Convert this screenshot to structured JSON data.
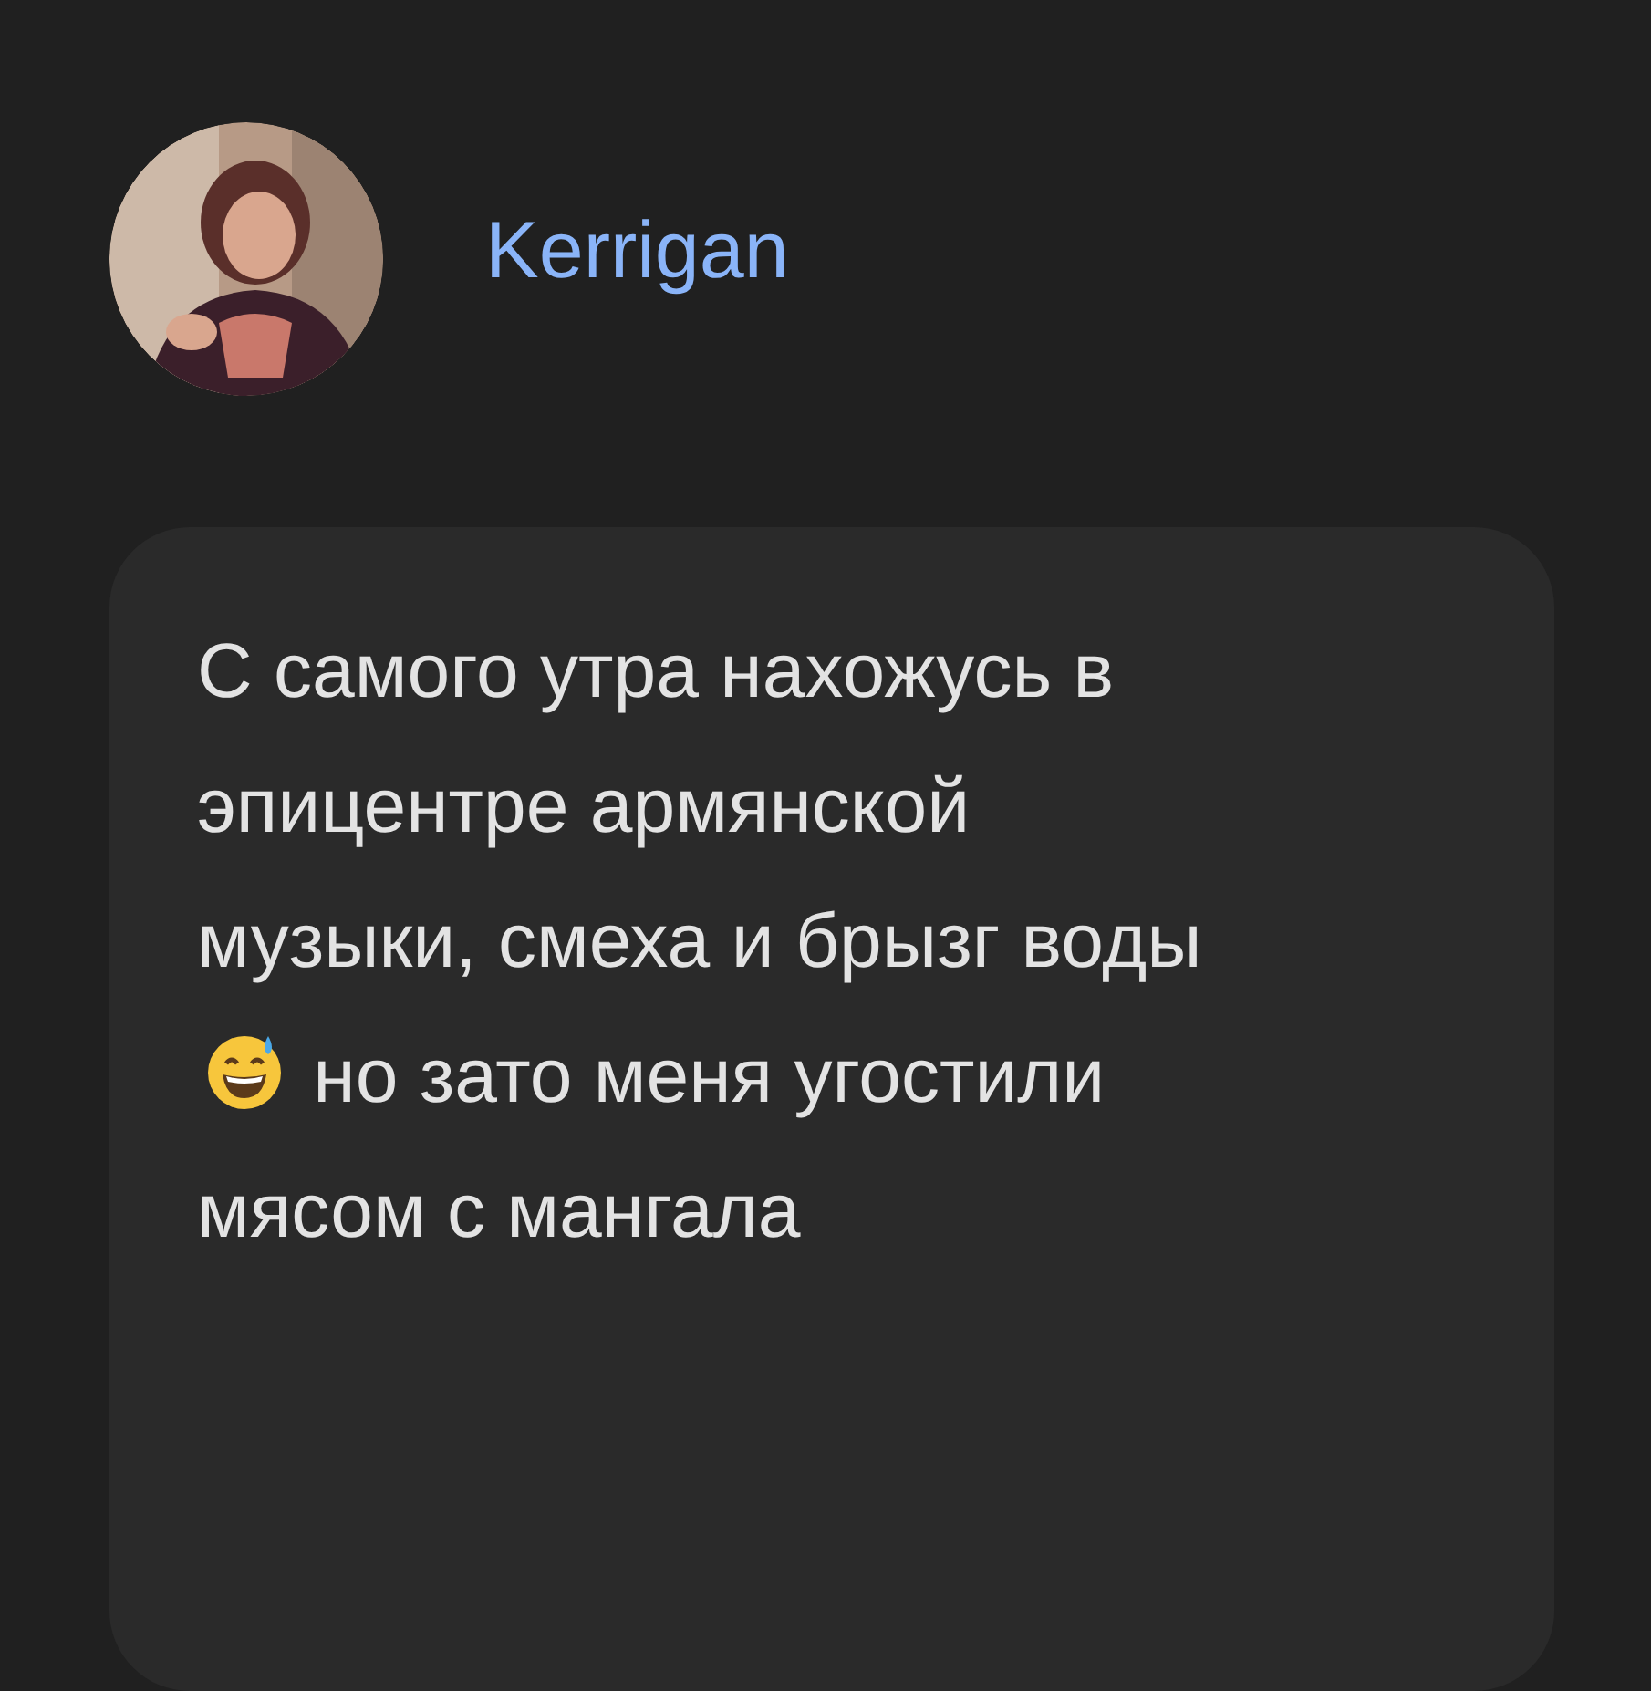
{
  "author": {
    "name": "Kerrigan"
  },
  "message": {
    "text_parts": [
      "С самого утра нахожусь в эпицентре армянской музыки, смеха и брызг воды",
      "но зато меня угостили мясом с мангала"
    ]
  }
}
